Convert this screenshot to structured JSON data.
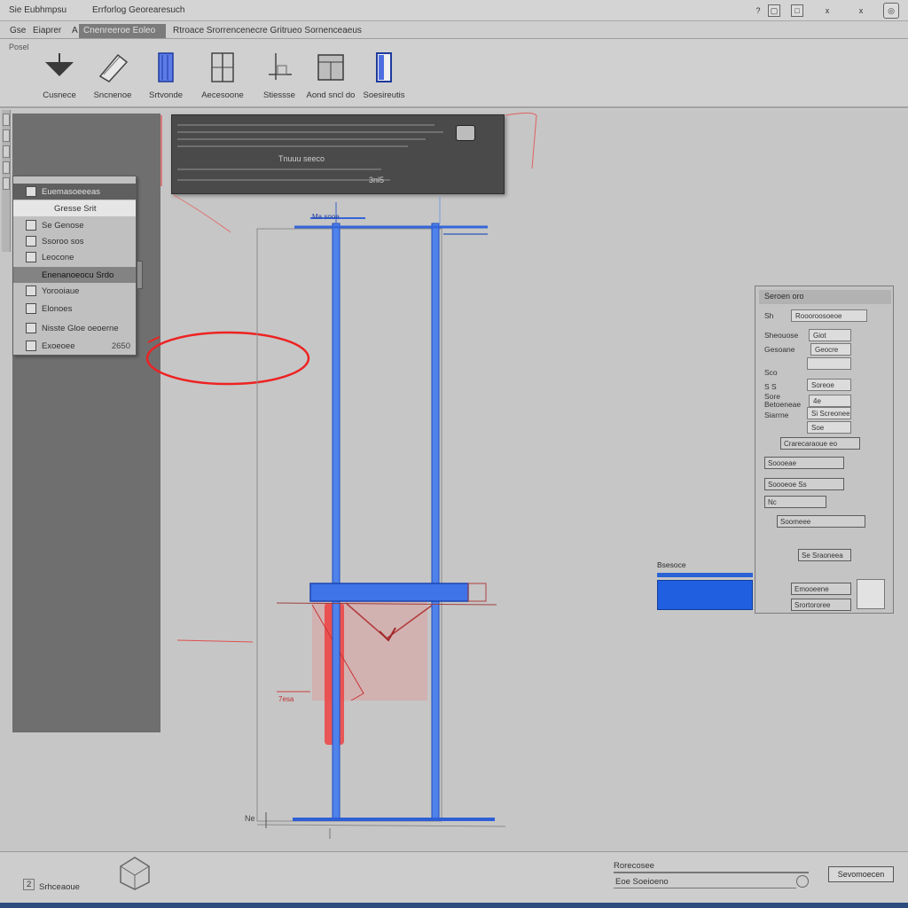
{
  "titlebar": {
    "app_title": "Sie Eubhmpsu",
    "doc_title": "Errforlog Georearesuch",
    "controls": [
      "?",
      "▢",
      "□",
      "x",
      "x"
    ]
  },
  "tabs": {
    "items": [
      {
        "label": "Gse"
      },
      {
        "label": "Eiaprer"
      },
      {
        "label": "A"
      },
      {
        "label": "Cnenreeroe Eoleo"
      },
      {
        "label": "Rtroace Srorrencenecre Gritrueo Sornenceaeus"
      }
    ],
    "active_index": 3
  },
  "ribbon": {
    "group_label": "Posel",
    "tools": [
      {
        "label": "Cusnece",
        "icon": "funnel-icon"
      },
      {
        "label": "Sncnenoe",
        "icon": "extrude-icon"
      },
      {
        "label": "Srtvonde",
        "icon": "blue-column-icon"
      },
      {
        "label": "Aecesoone",
        "icon": "window-icon"
      },
      {
        "label": "Stiessse",
        "icon": "section-icon"
      },
      {
        "label": "Aond sncl do",
        "icon": "cabinet-icon"
      },
      {
        "label": "Soesireutis",
        "icon": "door-icon"
      }
    ]
  },
  "context_menu": {
    "header": "Euemasoeeeas",
    "items": [
      {
        "label": "Gresse Srit"
      },
      {
        "label": "Se Genose"
      },
      {
        "label": "Ssoroo sos"
      },
      {
        "label": "Leocone"
      },
      {
        "label": "Enenanoeocu Srdo"
      },
      {
        "label": "Yorooiaue"
      },
      {
        "label": "Elonoes"
      },
      {
        "label": "Nisste Gloe oeoerne"
      },
      {
        "label": "Exoeoee",
        "shortcut": "2650"
      }
    ]
  },
  "dark_toolbar": {
    "caption": "Tnuuu seeco",
    "value": "3nl5"
  },
  "drawing": {
    "dimension_top": "Ma sooe",
    "dimension_left": "7esa",
    "base_label": "Ne",
    "colors": {
      "blue": "#2f6fe6",
      "red": "#ef3b3b"
    }
  },
  "properties": {
    "title": "Seroen oro",
    "fields": [
      {
        "label": "Sh",
        "value": "Roooroosoeoe"
      },
      {
        "label": "Sheouose",
        "value": "Giot"
      },
      {
        "label": "Gesoane",
        "value": "Geocre"
      },
      {
        "label": "Sco",
        "value": ""
      },
      {
        "label": "S S",
        "value": "Soreoe"
      },
      {
        "label": "Sore Betoeneae",
        "value": "4e"
      },
      {
        "label": "Siarrne",
        "value": "Si Screonee"
      },
      {
        "label": "",
        "value": "Soe"
      }
    ],
    "buttons": [
      "Crarecaraoue eo",
      "Soooeae",
      "Soooeoe Ss",
      "Nc",
      "Soomeee",
      "Se Sraoneea",
      "Emooeene",
      "Srortororee"
    ]
  },
  "layer_box": {
    "title": "Bsesoce"
  },
  "statusbar": {
    "left_text": "Srhceaoue",
    "left_num": "2",
    "center_label": "Rorecosee",
    "center_value": "Eoe Soeioeno",
    "button": "Sevomoecen"
  }
}
